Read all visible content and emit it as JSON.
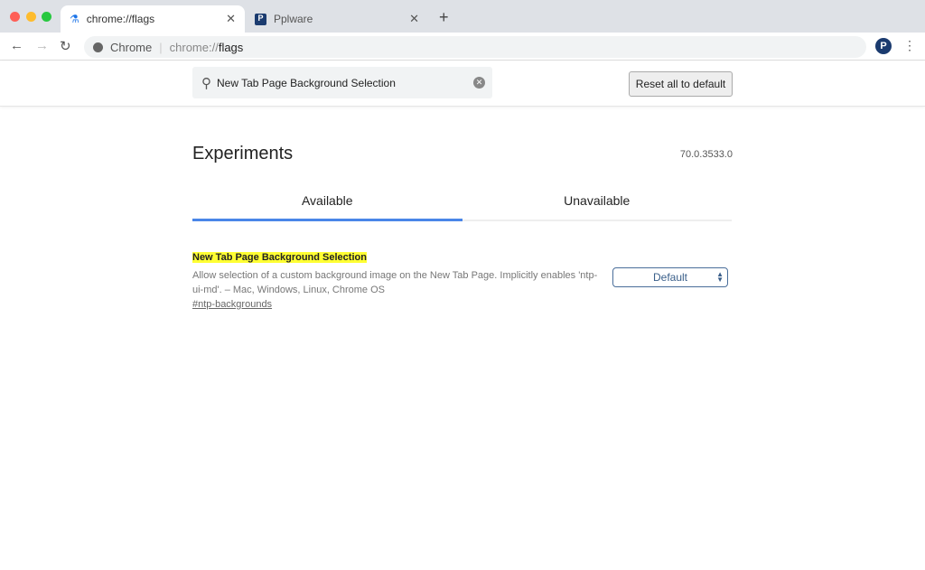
{
  "browser": {
    "tabs": [
      {
        "title": "chrome://flags",
        "icon": "flask-icon",
        "active": true
      },
      {
        "title": "Pplware",
        "icon": "pplware-favicon",
        "active": false
      }
    ],
    "omnibox": {
      "origin": "Chrome",
      "url_prefix": "chrome://",
      "url_host": "flags"
    }
  },
  "search": {
    "value": "New Tab Page Background Selection"
  },
  "reset_label": "Reset all to default",
  "page": {
    "title": "Experiments",
    "version": "70.0.3533.0",
    "tabs": [
      "Available",
      "Unavailable"
    ]
  },
  "experiment": {
    "name": "New Tab Page Background Selection",
    "description": "Allow selection of a custom background image on the New Tab Page. Implicitly enables 'ntp-ui-md'. – Mac, Windows, Linux, Chrome OS",
    "link": "#ntp-backgrounds",
    "value": "Default"
  },
  "colors": {
    "accent": "#4a86e8",
    "highlight": "#ffff33"
  }
}
